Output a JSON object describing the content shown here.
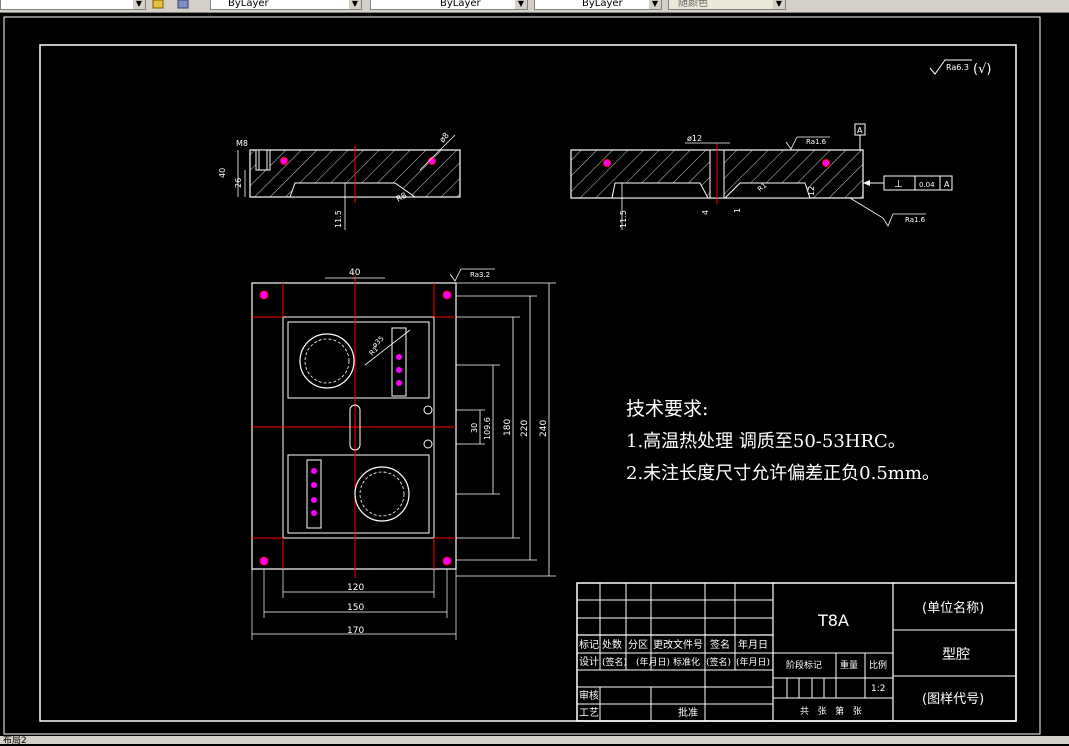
{
  "toolbar": {
    "layer_combo": "ByLayer",
    "linetype_combo": "ByLayer",
    "lineweight_combo": "ByLayer",
    "color_combo": "随颜色"
  },
  "status": {
    "layout_tab": "布局2"
  },
  "drawing": {
    "roughness_general": "Ra6.3",
    "roughness_general_paren": "(√)",
    "front_view": {
      "thread": "M8",
      "dia8": "ø8",
      "h40": "40",
      "h26": "26",
      "d11_5": "11.5",
      "r8": "R8"
    },
    "side_view": {
      "dia12": "ø12",
      "ra_top": "Ra1.6",
      "datum": "A",
      "tol_symbol": "⊥",
      "tol_value": "0.04",
      "tol_datum": "A",
      "d11_5": "11.5",
      "d4": "4",
      "d1": "1",
      "d12": "12",
      "ra_bottom": "Ra1.6",
      "r1": "R1"
    },
    "plan_view": {
      "ra_top": "Ra3.2",
      "w40": "40",
      "d35": "ø35",
      "r1": "R1",
      "h30": "30",
      "h109_6": "109.6",
      "h180": "180",
      "h220": "220",
      "h240": "240",
      "w120": "120",
      "w150": "150",
      "w170": "170"
    },
    "tech_requirements": {
      "title": "技术要求:",
      "item1": "1.高温热处理  调质至50-53HRC。",
      "item2": "2.未注长度尺寸允许偏差正负0.5mm。"
    },
    "title_block": {
      "material": "T8A",
      "unit_name": "(单位名称)",
      "part_name": "型腔",
      "drawing_code": "(图样代号)",
      "row_headers": [
        "标记",
        "处数",
        "分区",
        "更改文件号",
        "签名",
        "年月日"
      ],
      "row_design": [
        "设计",
        "(签名)",
        "(年月日)",
        "标准化",
        "(签名)",
        "(年月日)"
      ],
      "stage_mark": "阶段标记",
      "weight": "重量",
      "scale_label": "比例",
      "scale_value": "1:2",
      "review": "审核",
      "process": "工艺",
      "approve": "批准",
      "sheets": "共   张   第   张"
    }
  },
  "colors": {
    "background": "#000000",
    "line": "#ffffff",
    "center": "#ff0000",
    "hole": "#ff00ff",
    "toolbar": "#d4d0c8"
  }
}
